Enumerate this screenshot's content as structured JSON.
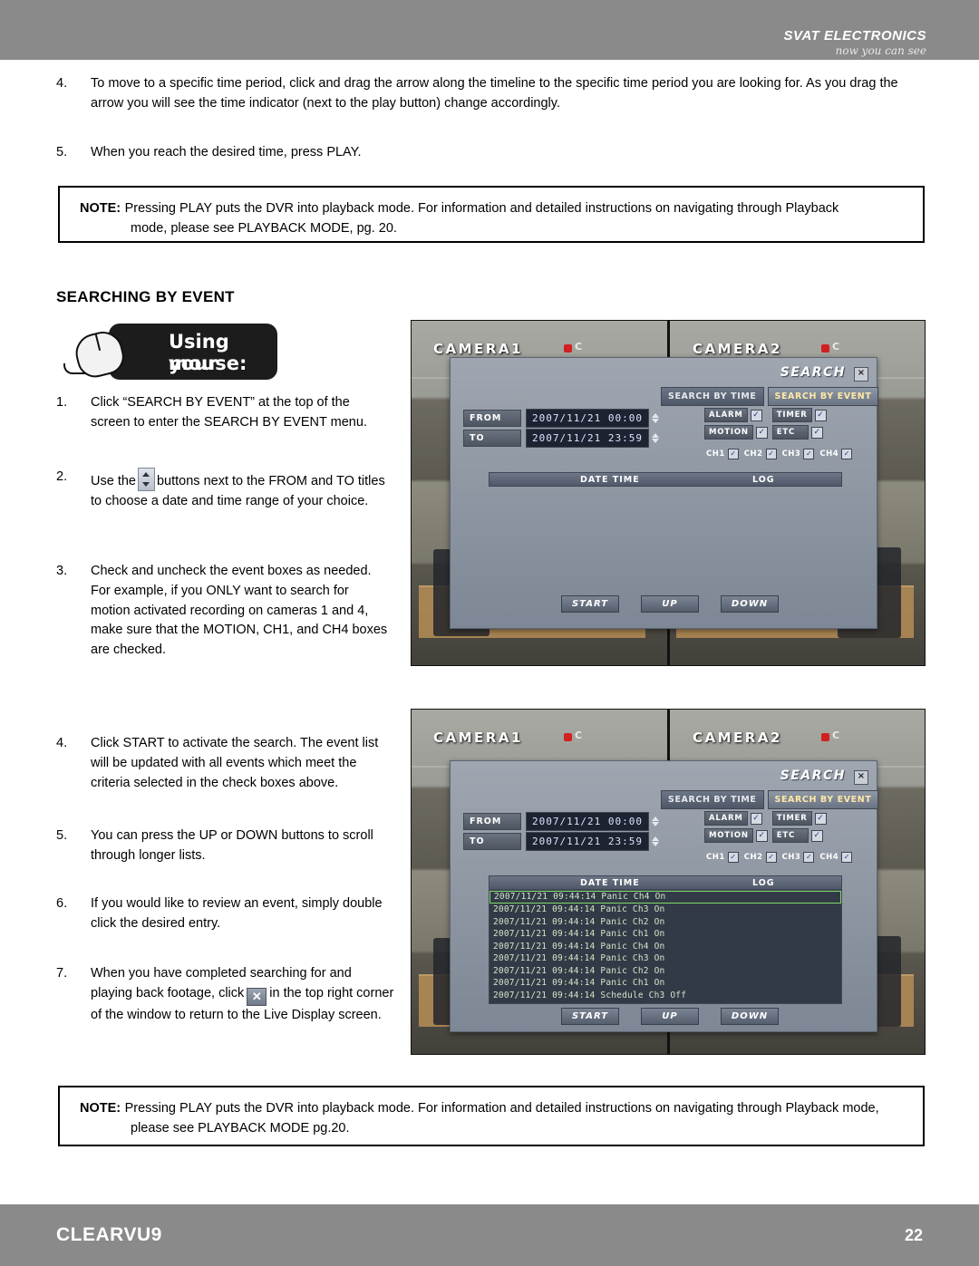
{
  "header": {
    "brand": "SVAT ELECTRONICS",
    "tagline": "now you can see"
  },
  "steps_top": [
    {
      "num": "4.",
      "text": "To move to a specific time period, click and drag the arrow along the timeline to the specific time period you are looking for.  As you drag the arrow you will see the time indicator (next to the play button) change accordingly."
    },
    {
      "num": "5.",
      "text": "When you reach the desired time, press PLAY."
    }
  ],
  "note_top": {
    "label": "NOTE:",
    "line1": "Pressing PLAY puts the DVR into playback mode.  For information and detailed instructions on navigating through Playback",
    "line2": "mode, please see PLAYBACK MODE, pg. 20."
  },
  "section_title": "SEARCHING BY EVENT",
  "mouse_callout": {
    "line1": "Using your",
    "line2": "mouse:"
  },
  "steps_mouse": [
    {
      "num": "1.",
      "text": "Click “SEARCH BY EVENT” at the top of the screen to enter the SEARCH BY EVENT menu."
    },
    {
      "num": "2.",
      "pre": "Use the",
      "post": "buttons next to the FROM and TO titles to choose a date and time range of your choice."
    },
    {
      "num": "3.",
      "text": "Check and uncheck the event boxes as needed. For example, if you ONLY want to search for motion activated recording on cameras 1 and 4, make sure that the MOTION, CH1, and CH4 boxes are checked."
    },
    {
      "num": "4.",
      "text": "Click START to activate the search.  The event list will be updated with all events which meet the criteria selected in the check boxes above."
    },
    {
      "num": "5.",
      "text": "You can press the UP or DOWN buttons to scroll through longer lists."
    },
    {
      "num": "6.",
      "text": "If you would like to review an event, simply double click the desired entry."
    },
    {
      "num": "7.",
      "pre": "When you have completed searching for and playing back footage, click",
      "post": "in the top right corner of the window to return to the Live Display screen."
    }
  ],
  "note_bottom": {
    "label": "NOTE:",
    "line1": "Pressing PLAY puts the DVR into playback mode.  For information and detailed instructions on navigating through Playback mode,",
    "line2": "please see PLAYBACK MODE pg.20."
  },
  "screenshot_top": {
    "camera_labels": [
      "CAMERA1",
      "CAMERA2"
    ],
    "rec_mark": "C",
    "dialog": {
      "title": "SEARCH",
      "close": "×",
      "tabs": [
        {
          "label": "SEARCH BY TIME",
          "active": false
        },
        {
          "label": "SEARCH BY EVENT",
          "active": true
        }
      ],
      "fields": [
        {
          "label": "FROM",
          "value": "2007/11/21 00:00"
        },
        {
          "label": "TO",
          "value": "2007/11/21 23:59"
        }
      ],
      "event_checks": [
        {
          "label": "ALARM",
          "checked": "✓"
        },
        {
          "label": "TIMER",
          "checked": "✓"
        },
        {
          "label": "MOTION",
          "checked": "✓"
        },
        {
          "label": "ETC",
          "checked": "✓"
        }
      ],
      "channel_checks": [
        {
          "label": "CH1",
          "checked": "✓"
        },
        {
          "label": "CH2",
          "checked": "✓"
        },
        {
          "label": "CH3",
          "checked": "✓"
        },
        {
          "label": "CH4",
          "checked": "✓"
        }
      ],
      "list_headers": [
        "DATE TIME",
        "LOG"
      ],
      "rows": [],
      "buttons": [
        "START",
        "UP",
        "DOWN"
      ]
    }
  },
  "screenshot_bottom": {
    "camera_labels": [
      "CAMERA1",
      "CAMERA2"
    ],
    "rec_mark": "C",
    "dialog": {
      "title": "SEARCH",
      "close": "×",
      "tabs": [
        {
          "label": "SEARCH BY TIME",
          "active": false
        },
        {
          "label": "SEARCH BY EVENT",
          "active": true
        }
      ],
      "fields": [
        {
          "label": "FROM",
          "value": "2007/11/21 00:00"
        },
        {
          "label": "TO",
          "value": "2007/11/21 23:59"
        }
      ],
      "event_checks": [
        {
          "label": "ALARM",
          "checked": "✓"
        },
        {
          "label": "TIMER",
          "checked": "✓"
        },
        {
          "label": "MOTION",
          "checked": "✓"
        },
        {
          "label": "ETC",
          "checked": "✓"
        }
      ],
      "channel_checks": [
        {
          "label": "CH1",
          "checked": "✓"
        },
        {
          "label": "CH2",
          "checked": "✓"
        },
        {
          "label": "CH3",
          "checked": "✓"
        },
        {
          "label": "CH4",
          "checked": "✓"
        }
      ],
      "list_headers": [
        "DATE TIME",
        "LOG"
      ],
      "rows": [
        {
          "datetime": "2007/11/21 09:44:14",
          "log": "Panic Ch4 On",
          "selected": true
        },
        {
          "datetime": "2007/11/21 09:44:14",
          "log": "Panic Ch3 On",
          "selected": false
        },
        {
          "datetime": "2007/11/21 09:44:14",
          "log": "Panic Ch2 On",
          "selected": false
        },
        {
          "datetime": "2007/11/21 09:44:14",
          "log": "Panic Ch1 On",
          "selected": false
        },
        {
          "datetime": "2007/11/21 09:44:14",
          "log": "Panic Ch4 On",
          "selected": false
        },
        {
          "datetime": "2007/11/21 09:44:14",
          "log": "Panic Ch3 On",
          "selected": false
        },
        {
          "datetime": "2007/11/21 09:44:14",
          "log": "Panic Ch2 On",
          "selected": false
        },
        {
          "datetime": "2007/11/21 09:44:14",
          "log": "Panic Ch1 On",
          "selected": false
        },
        {
          "datetime": "2007/11/21 09:44:14",
          "log": "Schedule Ch3 Off",
          "selected": false
        }
      ],
      "buttons": [
        "START",
        "UP",
        "DOWN"
      ]
    }
  },
  "footer": {
    "model": "CLEARVU9",
    "page": "22"
  }
}
